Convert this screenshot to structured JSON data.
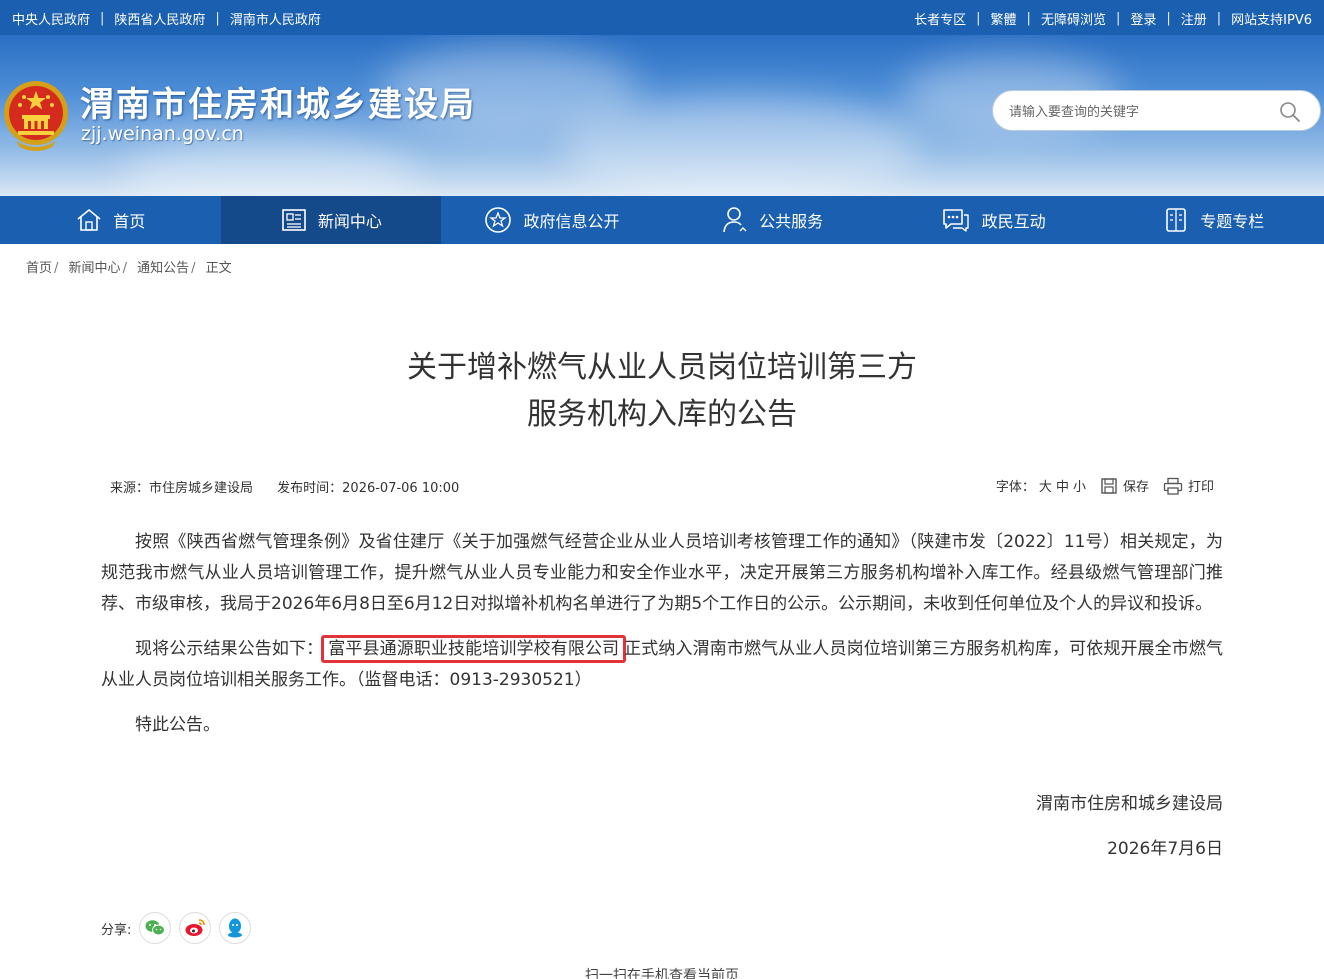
{
  "topbar": {
    "left_links": [
      "中央人民政府",
      "陕西省人民政府",
      "渭南市人民政府"
    ],
    "right_links": [
      "长者专区",
      "繁體",
      "无障碍浏览",
      "登录",
      "注册",
      "网站支持IPV6"
    ]
  },
  "header": {
    "site_title": "渭南市住房和城乡建设局",
    "domain": "zjj.weinan.gov.cn",
    "search_placeholder": "请输入要查询的关键字"
  },
  "nav": {
    "items": [
      {
        "label": "首页",
        "icon": "home-icon"
      },
      {
        "label": "新闻中心",
        "icon": "newspaper-icon",
        "active": true
      },
      {
        "label": "政府信息公开",
        "icon": "info-disclosure-icon"
      },
      {
        "label": "公共服务",
        "icon": "user-service-icon"
      },
      {
        "label": "政民互动",
        "icon": "chat-icon"
      },
      {
        "label": "专题专栏",
        "icon": "topic-icon"
      }
    ]
  },
  "breadcrumb": {
    "items": [
      "首页",
      "新闻中心",
      "通知公告"
    ],
    "current": "正文"
  },
  "article": {
    "title_line1": "关于增补燃气从业人员岗位培训第三方",
    "title_line2": "服务机构入库的公告",
    "source": "来源：市住房城乡建设局",
    "publish_time": "发布时间：2026-07-06 10:00",
    "font_label": "字体：",
    "font_sizes": [
      "大",
      "中",
      "小"
    ],
    "save_label": "保存",
    "print_label": "打印",
    "paragraph1": "按照《陕西省燃气管理条例》及省住建厅《关于加强燃气经营企业从业人员培训考核管理工作的通知》（陕建市发〔2022〕11号）相关规定，为规范我市燃气从业人员培训管理工作，提升燃气从业人员专业能力和安全作业水平，决定开展第三方服务机构增补入库工作。经县级燃气管理部门推荐、市级审核，我局于2026年6月8日至6月12日对拟增补机构名单进行了为期5个工作日的公示。公示期间，未收到任何单位及个人的异议和投诉。",
    "paragraph2_prefix": "现将公示结果公告如下：",
    "paragraph2_org": "富平县通源职业技能培训学校有限公司",
    "paragraph2_suffix": "正式纳入渭南市燃气从业人员岗位培训第三方服务机构库，可依规开展全市燃气从业人员岗位培训相关服务工作。（监督电话：0913-2930521）",
    "paragraph3": "特此公告。",
    "signature": "渭南市住房和城乡建设局",
    "date": "2026年7月6日"
  },
  "share": {
    "label": "分享:",
    "icons": [
      "wechat-icon",
      "weibo-icon",
      "qq-icon"
    ]
  },
  "qr_text": "扫一扫在手机查看当前页",
  "colors": {
    "primary": "#1a5fb0",
    "nav_active": "#14498a",
    "highlight_border": "#e2323a"
  }
}
